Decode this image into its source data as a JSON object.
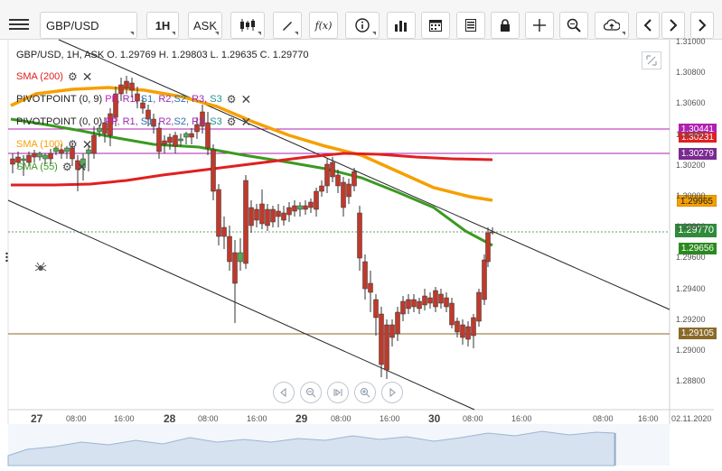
{
  "toolbar": {
    "symbol": "GBP/USD",
    "timeframe": "1H",
    "price_side": "ASK",
    "fx_label": "f(x)"
  },
  "chart": {
    "info": "GBP/USD, 1H, ASK   O. 1.29769 H. 1.29803 L. 1.29635 C. 1.29770",
    "indicators": {
      "sma200": "SMA (200)",
      "pivot1_prefix": "PIVOTPOINT (0, 9)",
      "pivot2_prefix": "PIVOTPOINT (0, 0)",
      "sma100": "SMA (100)",
      "sma55": "SMA (55)",
      "pp": "PP,",
      "r1": "R1,",
      "s1": "S1,",
      "r2": "R2,",
      "s2": "S2,",
      "r3": "R3,",
      "s3": "S3"
    },
    "price_tags": {
      "p1": "1.30441",
      "p2": "1.30231",
      "p3": "1.30279",
      "p4": "1.29965",
      "p5": "1.29770",
      "p6": "1.29656",
      "p7": "1.29105"
    },
    "colors": {
      "sma200": "#e02020",
      "sma100": "#f5a000",
      "sma55": "#3a9a20",
      "pivot": "#b020b0",
      "support": "#8a6a2a",
      "up": "#4caf50",
      "down": "#c0392b"
    },
    "y_labels": [
      "1.31000",
      "1.30800",
      "1.30600",
      "1.30400",
      "1.30200",
      "1.30000",
      "1.29800",
      "1.29600",
      "1.29400",
      "1.29200",
      "1.29000",
      "1.28800"
    ],
    "x_labels": [
      {
        "text": "27",
        "day": true
      },
      {
        "text": "08:00",
        "day": false
      },
      {
        "text": "16:00",
        "day": false
      },
      {
        "text": "28",
        "day": true
      },
      {
        "text": "08:00",
        "day": false
      },
      {
        "text": "16:00",
        "day": false
      },
      {
        "text": "29",
        "day": true
      },
      {
        "text": "08:00",
        "day": false
      },
      {
        "text": "16:00",
        "day": false
      },
      {
        "text": "30",
        "day": true
      },
      {
        "text": "08:00",
        "day": false
      },
      {
        "text": "16:00",
        "day": false
      },
      {
        "text": "08:00",
        "day": false
      },
      {
        "text": "16:00",
        "day": false
      },
      {
        "text": "02.11.2020",
        "day": false
      }
    ]
  }
}
